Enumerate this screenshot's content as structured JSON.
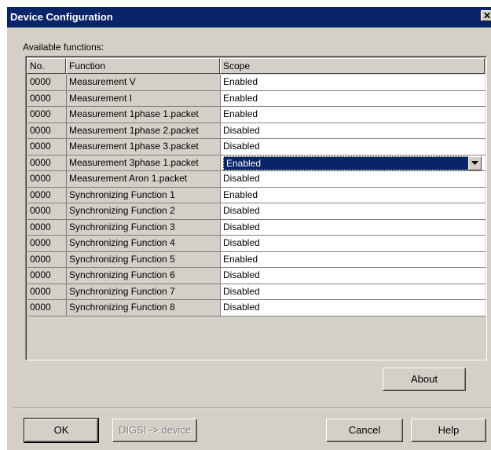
{
  "window": {
    "title": "Device Configuration",
    "close_glyph": "✕"
  },
  "list": {
    "label": "Available functions:",
    "columns": {
      "no": "No.",
      "function": "Function",
      "scope": "Scope"
    },
    "rows": [
      {
        "no": "0000",
        "function": "Measurement V",
        "scope": "Enabled"
      },
      {
        "no": "0000",
        "function": "Measurement I",
        "scope": "Enabled"
      },
      {
        "no": "0000",
        "function": "Measurement 1phase 1.packet",
        "scope": "Enabled"
      },
      {
        "no": "0000",
        "function": "Measurement 1phase 2.packet",
        "scope": "Disabled"
      },
      {
        "no": "0000",
        "function": "Measurement 1phase 3.packet",
        "scope": "Disabled"
      },
      {
        "no": "0000",
        "function": "Measurement 3phase 1.packet",
        "scope": "Enabled"
      },
      {
        "no": "0000",
        "function": "Measurement Aron 1.packet",
        "scope": "Disabled"
      },
      {
        "no": "0000",
        "function": "Synchronizing Function 1",
        "scope": "Enabled"
      },
      {
        "no": "0000",
        "function": "Synchronizing Function 2",
        "scope": "Disabled"
      },
      {
        "no": "0000",
        "function": "Synchronizing Function 3",
        "scope": "Disabled"
      },
      {
        "no": "0000",
        "function": "Synchronizing Function 4",
        "scope": "Disabled"
      },
      {
        "no": "0000",
        "function": "Synchronizing Function 5",
        "scope": "Enabled"
      },
      {
        "no": "0000",
        "function": "Synchronizing Function 6",
        "scope": "Disabled"
      },
      {
        "no": "0000",
        "function": "Synchronizing Function 7",
        "scope": "Disabled"
      },
      {
        "no": "0000",
        "function": "Synchronizing Function 8",
        "scope": "Disabled"
      }
    ],
    "selected_index": 5
  },
  "buttons": {
    "about": "About",
    "ok": "OK",
    "digsi": "DIGSI -> device",
    "cancel": "Cancel",
    "help": "Help"
  },
  "colors": {
    "title_bar": "#0a246a",
    "dialog_face": "#d4d0c8",
    "selection": "#0a246a"
  }
}
